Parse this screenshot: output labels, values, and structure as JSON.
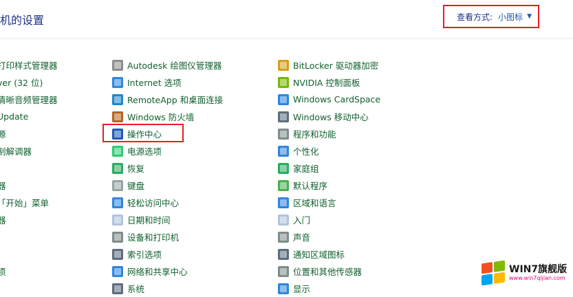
{
  "header": {
    "title": "机的设置",
    "view_label": "查看方式:",
    "view_value": "小图标"
  },
  "columns": [
    {
      "items": [
        {
          "label": "打印样式管理器",
          "icon": "printer-icon",
          "color": "#6b7fa6"
        },
        {
          "label": "ver (32 位)",
          "icon": "flash-icon",
          "color": "#c0392b"
        },
        {
          "label": "清晰音频管理器",
          "icon": "audio-icon",
          "color": "#e67e22"
        },
        {
          "label": "Update",
          "icon": "update-icon",
          "color": "#2e86de"
        },
        {
          "label": "源",
          "icon": "folder-icon",
          "color": "#e1b12c"
        },
        {
          "label": "制解调器",
          "icon": "modem-icon",
          "color": "#7f8c8d"
        },
        {
          "label": "",
          "icon": "",
          "color": ""
        },
        {
          "label": "器",
          "icon": "device-icon",
          "color": "#7f8c8d"
        },
        {
          "label": "「开始」菜单",
          "icon": "start-menu-icon",
          "color": "#2e86de"
        },
        {
          "label": "器",
          "icon": "device-icon",
          "color": "#7f8c8d"
        },
        {
          "label": "",
          "icon": "",
          "color": ""
        },
        {
          "label": "",
          "icon": "",
          "color": ""
        },
        {
          "label": "项",
          "icon": "options-icon",
          "color": "#7f8c8d"
        }
      ]
    },
    {
      "items": [
        {
          "label": "Autodesk 绘图仪管理器",
          "icon": "plotter-icon",
          "color": "#8e8e8e"
        },
        {
          "label": "Internet 选项",
          "icon": "internet-options-icon",
          "color": "#2e86de"
        },
        {
          "label": "RemoteApp 和桌面连接",
          "icon": "remote-desktop-icon",
          "color": "#1e88c8"
        },
        {
          "label": "Windows 防火墙",
          "icon": "firewall-icon",
          "color": "#b5651d"
        },
        {
          "label": "操作中心",
          "icon": "flag-icon",
          "color": "#1e59b6"
        },
        {
          "label": "电源选项",
          "icon": "power-icon",
          "color": "#2ecc71"
        },
        {
          "label": "恢复",
          "icon": "recovery-icon",
          "color": "#27ae60"
        },
        {
          "label": "键盘",
          "icon": "keyboard-icon",
          "color": "#95a5a6"
        },
        {
          "label": "轻松访问中心",
          "icon": "ease-of-access-icon",
          "color": "#2e86de"
        },
        {
          "label": "日期和时间",
          "icon": "calendar-clock-icon",
          "color": "#b0c4de"
        },
        {
          "label": "设备和打印机",
          "icon": "devices-printers-icon",
          "color": "#7f8c8d"
        },
        {
          "label": "索引选项",
          "icon": "index-options-icon",
          "color": "#5d6d7e"
        },
        {
          "label": "网络和共享中心",
          "icon": "network-icon",
          "color": "#2e86de"
        },
        {
          "label": "系统",
          "icon": "system-icon",
          "color": "#5d6d7e"
        }
      ]
    },
    {
      "items": [
        {
          "label": "BitLocker 驱动器加密",
          "icon": "bitlocker-icon",
          "color": "#d4a017"
        },
        {
          "label": "NVIDIA 控制面板",
          "icon": "nvidia-icon",
          "color": "#76b900"
        },
        {
          "label": "Windows CardSpace",
          "icon": "cardspace-icon",
          "color": "#2e86de"
        },
        {
          "label": "Windows 移动中心",
          "icon": "mobility-center-icon",
          "color": "#5d6d7e"
        },
        {
          "label": "程序和功能",
          "icon": "programs-icon",
          "color": "#7f8c8d"
        },
        {
          "label": "个性化",
          "icon": "personalization-icon",
          "color": "#2e86de"
        },
        {
          "label": "家庭组",
          "icon": "homegroup-icon",
          "color": "#27ae60"
        },
        {
          "label": "默认程序",
          "icon": "default-programs-icon",
          "color": "#4caf50"
        },
        {
          "label": "区域和语言",
          "icon": "region-language-icon",
          "color": "#2e86de"
        },
        {
          "label": "入门",
          "icon": "getting-started-icon",
          "color": "#b0c4de"
        },
        {
          "label": "声音",
          "icon": "speaker-icon",
          "color": "#7f8c8d"
        },
        {
          "label": "通知区域图标",
          "icon": "notification-icon",
          "color": "#5d6d7e"
        },
        {
          "label": "位置和其他传感器",
          "icon": "sensor-icon",
          "color": "#7f8c8d"
        },
        {
          "label": "显示",
          "icon": "display-icon",
          "color": "#2e86de"
        }
      ]
    }
  ],
  "watermark": {
    "text_big": "WIN7旗舰版",
    "text_small": "www.win7qijian.com",
    "logo_colors": [
      "#f25022",
      "#7fba00",
      "#00a4ef",
      "#ffb900"
    ]
  },
  "colors": {
    "title": "#1e3287",
    "link": "#0f5f2c",
    "highlight": "#e81c24"
  }
}
